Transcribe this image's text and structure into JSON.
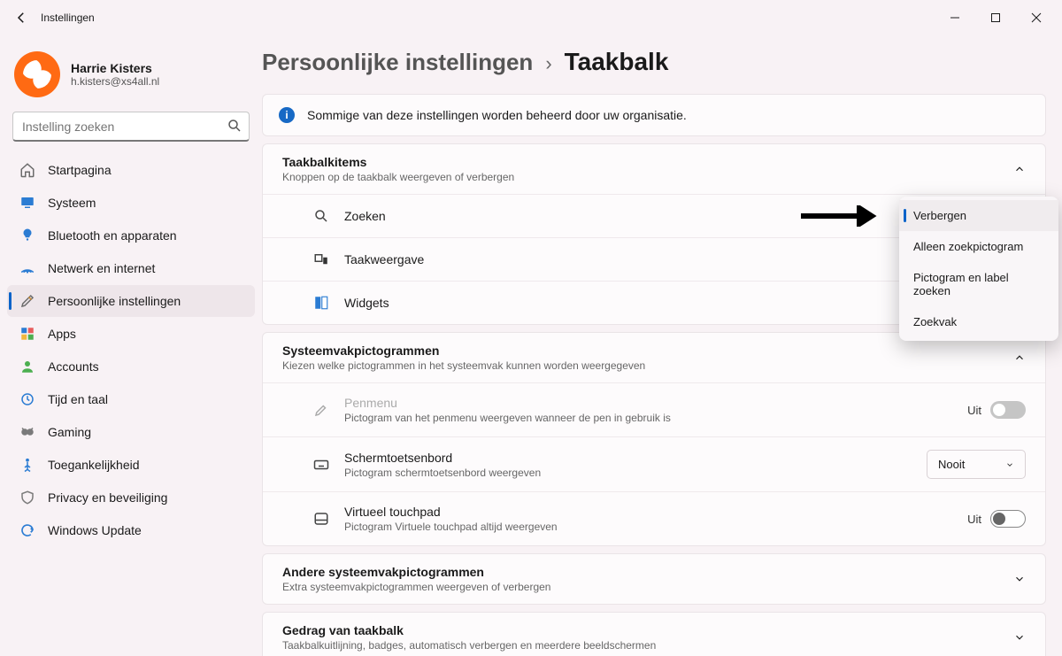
{
  "window": {
    "title": "Instellingen"
  },
  "profile": {
    "name": "Harrie Kisters",
    "email": "h.kisters@xs4all.nl"
  },
  "search": {
    "placeholder": "Instelling zoeken"
  },
  "sidebar": {
    "items": [
      {
        "label": "Startpagina",
        "name": "sidebar-item-home"
      },
      {
        "label": "Systeem",
        "name": "sidebar-item-system"
      },
      {
        "label": "Bluetooth en apparaten",
        "name": "sidebar-item-bluetooth"
      },
      {
        "label": "Netwerk en internet",
        "name": "sidebar-item-network"
      },
      {
        "label": "Persoonlijke instellingen",
        "name": "sidebar-item-personalization"
      },
      {
        "label": "Apps",
        "name": "sidebar-item-apps"
      },
      {
        "label": "Accounts",
        "name": "sidebar-item-accounts"
      },
      {
        "label": "Tijd en taal",
        "name": "sidebar-item-time-language"
      },
      {
        "label": "Gaming",
        "name": "sidebar-item-gaming"
      },
      {
        "label": "Toegankelijkheid",
        "name": "sidebar-item-accessibility"
      },
      {
        "label": "Privacy en beveiliging",
        "name": "sidebar-item-privacy"
      },
      {
        "label": "Windows Update",
        "name": "sidebar-item-windows-update"
      }
    ],
    "active_index": 4
  },
  "breadcrumb": {
    "parent": "Persoonlijke instellingen",
    "current": "Taakbalk"
  },
  "banner": {
    "text": "Sommige van deze instellingen worden beheerd door uw organisatie."
  },
  "sections": {
    "taskbar_items": {
      "title": "Taakbalkitems",
      "subtitle": "Knoppen op de taakbalk weergeven of verbergen",
      "rows": [
        {
          "label": "Zoeken"
        },
        {
          "label": "Taakweergave"
        },
        {
          "label": "Widgets"
        }
      ]
    },
    "systray": {
      "title": "Systeemvakpictogrammen",
      "subtitle": "Kiezen welke pictogrammen in het systeemvak kunnen worden weergegeven",
      "rows": [
        {
          "label": "Penmenu",
          "sub": "Pictogram van het penmenu weergeven wanneer de pen in gebruik is",
          "state": "Uit"
        },
        {
          "label": "Schermtoetsenbord",
          "sub": "Pictogram schermtoetsenbord weergeven",
          "select": "Nooit"
        },
        {
          "label": "Virtueel touchpad",
          "sub": "Pictogram Virtuele touchpad altijd weergeven",
          "state": "Uit"
        }
      ]
    },
    "other_systray": {
      "title": "Andere systeemvakpictogrammen",
      "subtitle": "Extra systeemvakpictogrammen weergeven of verbergen"
    },
    "behavior": {
      "title": "Gedrag van taakbalk",
      "subtitle": "Taakbalkuitlijning, badges, automatisch verbergen en meerdere beeldschermen"
    }
  },
  "dropdown": {
    "items": [
      {
        "label": "Verbergen",
        "selected": true
      },
      {
        "label": "Alleen zoekpictogram"
      },
      {
        "label": "Pictogram en label zoeken"
      },
      {
        "label": "Zoekvak"
      }
    ]
  }
}
